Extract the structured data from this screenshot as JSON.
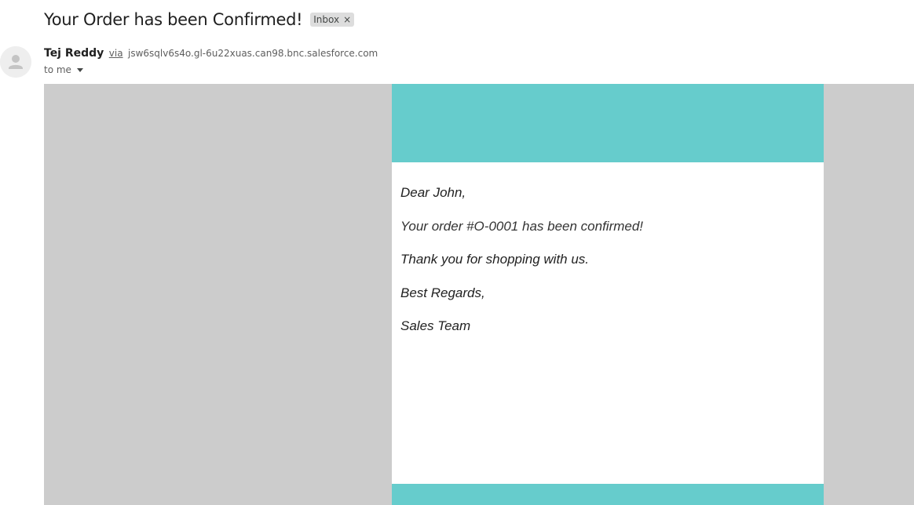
{
  "email": {
    "subject": "Your Order has been Confirmed!",
    "label": "Inbox",
    "label_close": "×",
    "sender": {
      "name": "Tej Reddy",
      "via": "via",
      "domain": "jsw6sqlv6s4o.gl-6u22xuas.can98.bnc.salesforce.com"
    },
    "recipient": "to me",
    "body": {
      "greeting": "Dear John,",
      "line1": "Your order #O-0001 has been confirmed!",
      "line2": "Thank you for shopping with us.",
      "signoff": "Best Regards,",
      "signature": "Sales Team"
    }
  },
  "colors": {
    "banner": "#66cccc",
    "canvas": "#cccccc",
    "chip": "#dddddd"
  },
  "icons": {
    "avatar": "default-person-avatar-icon",
    "label_close": "close-icon",
    "recipient_toggle": "caret-down-icon"
  }
}
